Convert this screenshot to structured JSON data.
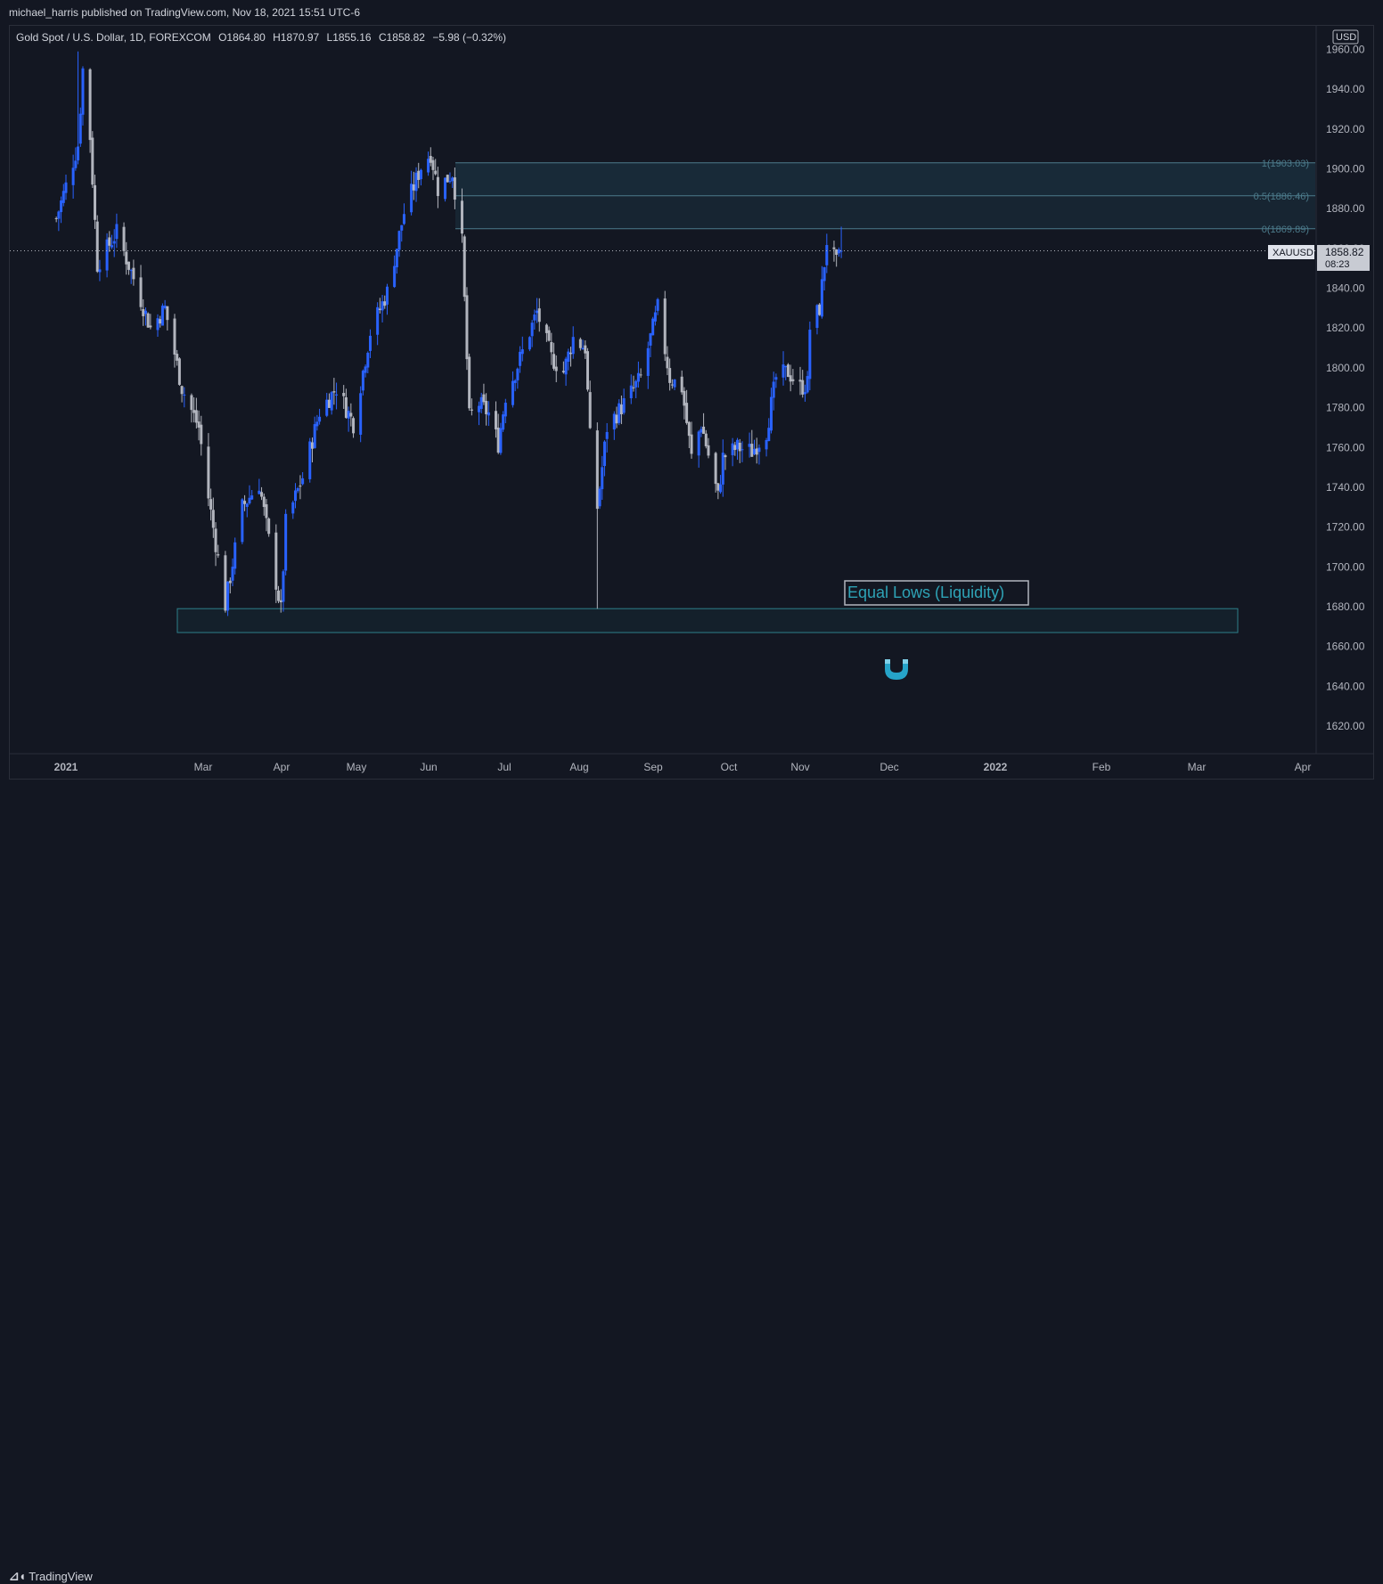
{
  "header": {
    "published": "michael_harris published on TradingView.com, Nov 18, 2021 15:51 UTC-6"
  },
  "legend": {
    "symbol": "Gold Spot / U.S. Dollar, 1D, FOREXCOM",
    "open": "O1864.80",
    "high": "H1870.97",
    "low": "L1855.16",
    "close": "C1858.82",
    "change": "−5.98 (−0.32%)"
  },
  "price_axis": {
    "currency": "USD",
    "labels": [
      "1960.00",
      "1940.00",
      "1920.00",
      "1900.00",
      "1880.00",
      "1860.00",
      "1840.00",
      "1820.00",
      "1800.00",
      "1780.00",
      "1760.00",
      "1740.00",
      "1720.00",
      "1700.00",
      "1680.00",
      "1660.00",
      "1640.00",
      "1620.00"
    ]
  },
  "time_axis": {
    "labels": [
      "2021",
      "Mar",
      "Apr",
      "May",
      "Jun",
      "Jul",
      "Aug",
      "Sep",
      "Oct",
      "Nov",
      "Dec",
      "2022",
      "Feb",
      "Mar",
      "Apr"
    ]
  },
  "current_price": {
    "symbol_tag": "XAUUSD",
    "price": "1858.82",
    "countdown": "08:23"
  },
  "fib_levels": [
    {
      "label": "1(1903.03)",
      "price": 1903.03
    },
    {
      "label": "0.5(1886.46)",
      "price": 1886.46
    },
    {
      "label": "0(1869.89)",
      "price": 1869.89
    }
  ],
  "annotation": {
    "text": "Equal Lows (Liquidity)",
    "zone_top": 1679,
    "zone_bottom": 1667,
    "icon": "magnet-icon"
  },
  "footer": {
    "brand": "TradingView"
  },
  "colors": {
    "background": "#131722",
    "up": "#2962ff",
    "down": "#b2b5be",
    "fib": "#4c7b8b",
    "liquidity": "#2e7f8a",
    "magnet": "#26a4c9"
  },
  "chart_data": {
    "type": "candlestick",
    "title": "Gold Spot / U.S. Dollar, 1D, FOREXCOM",
    "ylim": [
      1608,
      1962
    ],
    "y_ticks": [
      1620,
      1640,
      1660,
      1680,
      1700,
      1720,
      1740,
      1760,
      1780,
      1800,
      1820,
      1840,
      1860,
      1880,
      1900,
      1920,
      1940,
      1960
    ],
    "x_ticks": [
      "2021",
      "Mar",
      "Apr",
      "May",
      "Jun",
      "Jul",
      "Aug",
      "Sep",
      "Oct",
      "Nov",
      "Dec",
      "2022",
      "Feb",
      "Mar",
      "Apr"
    ],
    "last_close": 1858.82,
    "close_path": [
      {
        "date": "2020-12-28",
        "close": 1875
      },
      {
        "date": "2021-01-06",
        "close": 1912
      },
      {
        "date": "2021-01-08",
        "close": 1950
      },
      {
        "date": "2021-01-11",
        "close": 1916
      },
      {
        "date": "2021-01-14",
        "close": 1852
      },
      {
        "date": "2021-01-22",
        "close": 1868
      },
      {
        "date": "2021-01-29",
        "close": 1845
      },
      {
        "date": "2021-02-05",
        "close": 1820
      },
      {
        "date": "2021-02-11",
        "close": 1830
      },
      {
        "date": "2021-02-18",
        "close": 1790
      },
      {
        "date": "2021-02-25",
        "close": 1770
      },
      {
        "date": "2021-03-01",
        "close": 1735
      },
      {
        "date": "2021-03-08",
        "close": 1681
      },
      {
        "date": "2021-03-15",
        "close": 1730
      },
      {
        "date": "2021-03-22",
        "close": 1742
      },
      {
        "date": "2021-03-31",
        "close": 1678
      },
      {
        "date": "2021-04-02",
        "close": 1722
      },
      {
        "date": "2021-04-09",
        "close": 1745
      },
      {
        "date": "2021-04-16",
        "close": 1778
      },
      {
        "date": "2021-04-23",
        "close": 1790
      },
      {
        "date": "2021-04-30",
        "close": 1772
      },
      {
        "date": "2021-05-07",
        "close": 1818
      },
      {
        "date": "2021-05-14",
        "close": 1838
      },
      {
        "date": "2021-05-21",
        "close": 1878
      },
      {
        "date": "2021-05-28",
        "close": 1901
      },
      {
        "date": "2021-06-01",
        "close": 1908
      },
      {
        "date": "2021-06-04",
        "close": 1890
      },
      {
        "date": "2021-06-10",
        "close": 1898
      },
      {
        "date": "2021-06-14",
        "close": 1863
      },
      {
        "date": "2021-06-17",
        "close": 1775
      },
      {
        "date": "2021-06-21",
        "close": 1782
      },
      {
        "date": "2021-06-25",
        "close": 1777
      },
      {
        "date": "2021-06-29",
        "close": 1762
      },
      {
        "date": "2021-07-02",
        "close": 1786
      },
      {
        "date": "2021-07-06",
        "close": 1798
      },
      {
        "date": "2021-07-09",
        "close": 1808
      },
      {
        "date": "2021-07-15",
        "close": 1828
      },
      {
        "date": "2021-07-21",
        "close": 1805
      },
      {
        "date": "2021-07-26",
        "close": 1798
      },
      {
        "date": "2021-07-30",
        "close": 1815
      },
      {
        "date": "2021-08-04",
        "close": 1810
      },
      {
        "date": "2021-08-06",
        "close": 1765
      },
      {
        "date": "2021-08-09",
        "close": 1730
      },
      {
        "date": "2021-08-13",
        "close": 1770
      },
      {
        "date": "2021-08-20",
        "close": 1782
      },
      {
        "date": "2021-08-27",
        "close": 1795
      },
      {
        "date": "2021-09-03",
        "close": 1830
      },
      {
        "date": "2021-09-08",
        "close": 1795
      },
      {
        "date": "2021-09-13",
        "close": 1790
      },
      {
        "date": "2021-09-17",
        "close": 1755
      },
      {
        "date": "2021-09-21",
        "close": 1772
      },
      {
        "date": "2021-09-28",
        "close": 1735
      },
      {
        "date": "2021-09-30",
        "close": 1755
      },
      {
        "date": "2021-10-06",
        "close": 1760
      },
      {
        "date": "2021-10-12",
        "close": 1758
      },
      {
        "date": "2021-10-18",
        "close": 1768
      },
      {
        "date": "2021-10-22",
        "close": 1795
      },
      {
        "date": "2021-10-27",
        "close": 1798
      },
      {
        "date": "2021-11-01",
        "close": 1790
      },
      {
        "date": "2021-11-04",
        "close": 1792
      },
      {
        "date": "2021-11-05",
        "close": 1820
      },
      {
        "date": "2021-11-09",
        "close": 1830
      },
      {
        "date": "2021-11-12",
        "close": 1864
      },
      {
        "date": "2021-11-16",
        "close": 1852
      },
      {
        "date": "2021-11-18",
        "close": 1858.82
      }
    ]
  }
}
